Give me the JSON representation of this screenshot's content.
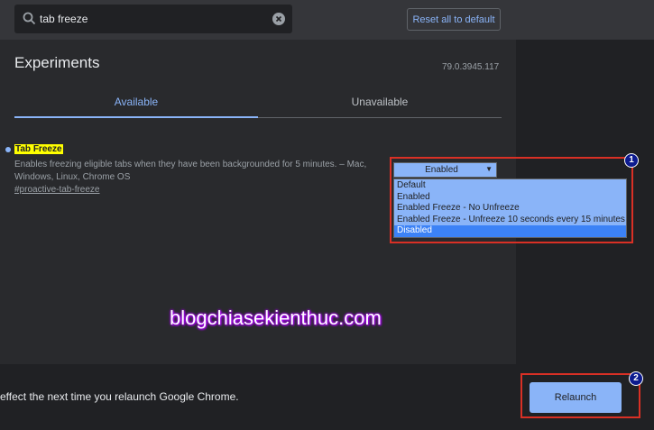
{
  "search": {
    "value": "tab freeze",
    "icon": "search-icon",
    "clear_icon": "clear-icon"
  },
  "header": {
    "reset_label": "Reset all to default"
  },
  "page": {
    "title": "Experiments",
    "version": "79.0.3945.117"
  },
  "tabs": [
    {
      "label": "Available",
      "active": true
    },
    {
      "label": "Unavailable",
      "active": false
    }
  ],
  "flag": {
    "title": "Tab Freeze",
    "description": "Enables freezing eligible tabs when they have been backgrounded for 5 minutes. – Mac, Windows, Linux, Chrome OS",
    "link": "#proactive-tab-freeze",
    "selected": "Enabled",
    "options": [
      "Default",
      "Enabled",
      "Enabled Freeze - No Unfreeze",
      "Enabled Freeze - Unfreeze 10 seconds every 15 minutes",
      "Disabled"
    ],
    "highlighted_option": "Disabled"
  },
  "annotations": {
    "badge1": "1",
    "badge2": "2"
  },
  "watermark": "blogchiasekienthuc.com",
  "bottom": {
    "message": "effect the next time you relaunch Google Chrome.",
    "relaunch_label": "Relaunch"
  },
  "colors": {
    "accent": "#8ab4f8",
    "background": "#292a2d",
    "annotation": "#d93025",
    "highlight": "#ffff00"
  }
}
